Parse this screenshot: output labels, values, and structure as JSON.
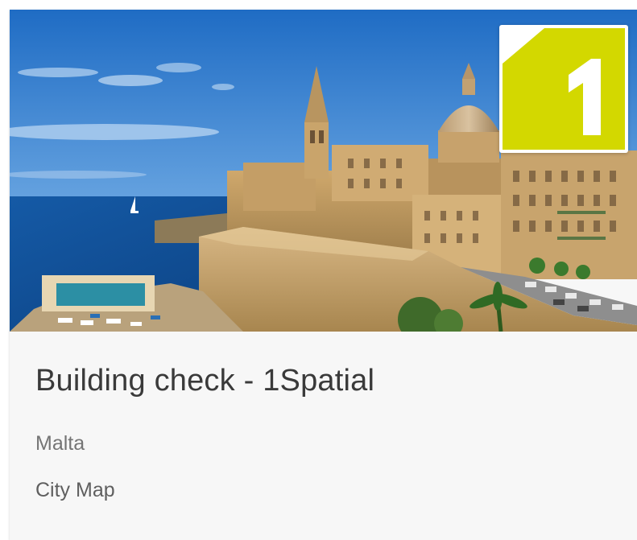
{
  "card": {
    "title": "Building check - 1Spatial",
    "location": "Malta",
    "category": "City Map"
  },
  "logo": {
    "text": "1",
    "color": "#d3d800"
  },
  "colors": {
    "sky": "#2f7fd1",
    "sea": "#0f4f9a",
    "stone": "#c9a874",
    "card_bg": "#f7f7f7",
    "title": "#3a3a3a",
    "subtitle": "#757575"
  }
}
